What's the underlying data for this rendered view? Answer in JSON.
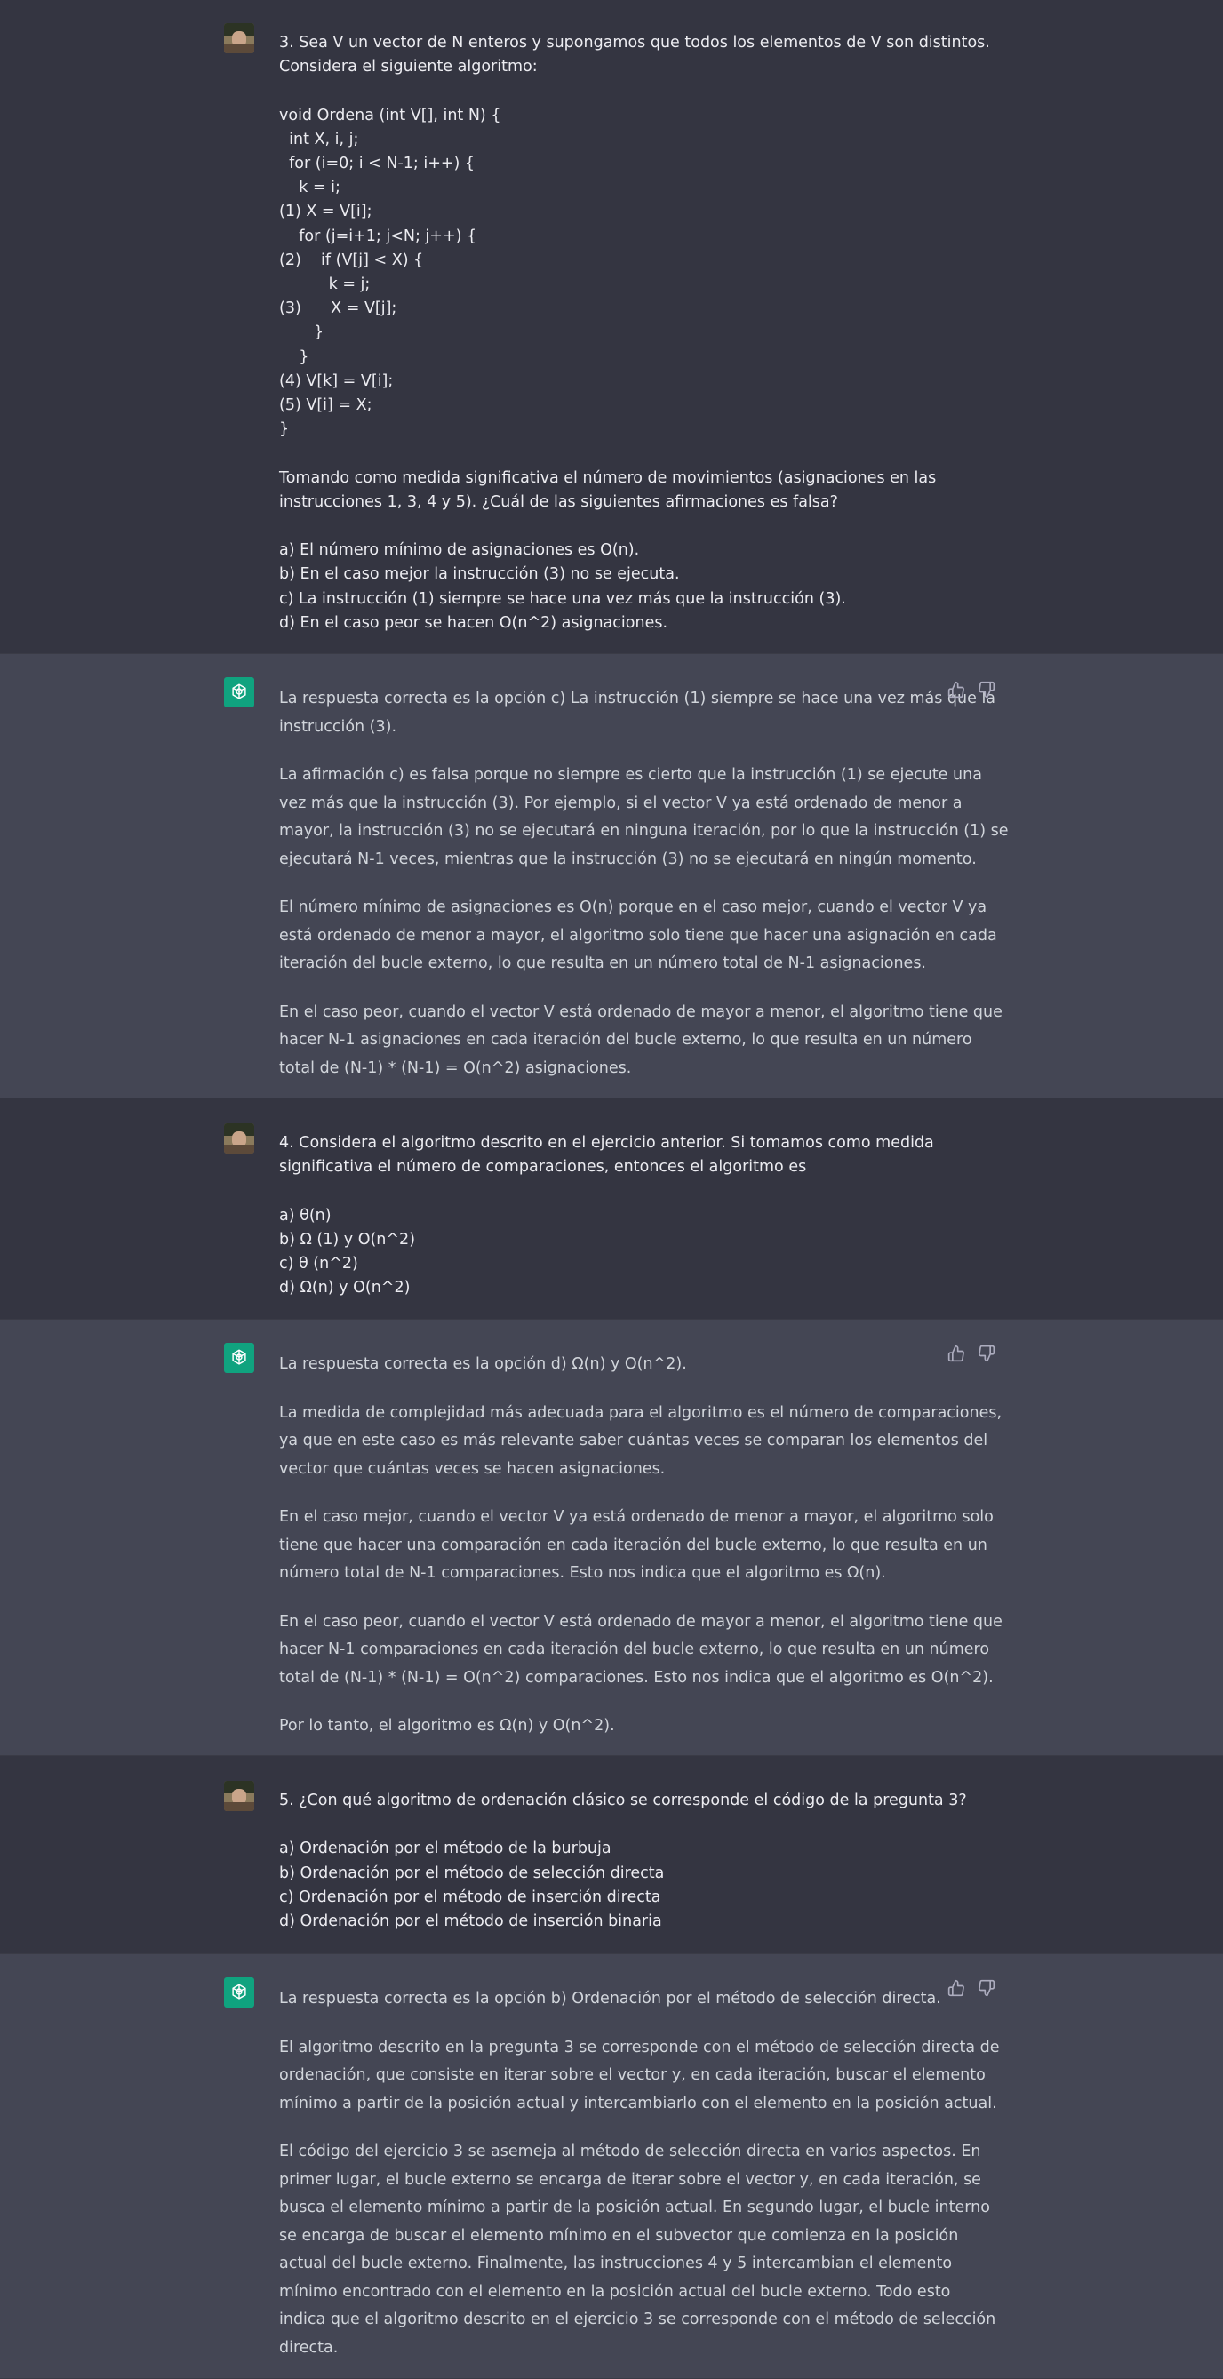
{
  "conversation": [
    {
      "role": "user",
      "paragraphs": [
        [
          "3. Sea V un vector de N enteros y supongamos que todos los elementos de V son distintos.",
          "Considera el siguiente algoritmo:"
        ],
        [
          "void Ordena (int V[], int N) {",
          "  int X, i, j;",
          "  for (i=0; i < N-1; i++) {",
          "    k = i;",
          "(1) X = V[i];",
          "    for (j=i+1; j<N; j++) {",
          "(2)    if (V[j] < X) {",
          "          k = j;",
          "(3)      X = V[j];",
          "       }",
          "    }",
          "(4) V[k] = V[i];",
          "(5) V[i] = X;",
          "}"
        ],
        [
          "Tomando como medida significativa el número de movimientos (asignaciones en las",
          "instrucciones 1, 3, 4 y 5). ¿Cuál de las siguientes afirmaciones es falsa?"
        ],
        [
          "a) El número mínimo de asignaciones es O(n).",
          "b) En el caso mejor la instrucción (3) no se ejecuta.",
          "c) La instrucción (1) siempre se hace una vez más que la instrucción (3).",
          "d) En el caso peor se hacen O(n^2) asignaciones."
        ]
      ]
    },
    {
      "role": "assistant",
      "paragraphs": [
        [
          "La respuesta correcta es la opción c) La instrucción (1) siempre se hace una vez más que la",
          "instrucción (3)."
        ],
        [
          "La afirmación c) es falsa porque no siempre es cierto que la instrucción (1) se ejecute una",
          "vez más que la instrucción (3). Por ejemplo, si el vector V ya está ordenado de menor a",
          "mayor, la instrucción (3) no se ejecutará en ninguna iteración, por lo que la instrucción (1) se",
          "ejecutará N-1 veces, mientras que la instrucción (3) no se ejecutará en ningún momento."
        ],
        [
          "El número mínimo de asignaciones es O(n) porque en el caso mejor, cuando el vector V ya",
          "está ordenado de menor a mayor, el algoritmo solo tiene que hacer una asignación en cada",
          "iteración del bucle externo, lo que resulta en un número total de N-1 asignaciones."
        ],
        [
          "En el caso peor, cuando el vector V está ordenado de mayor a menor, el algoritmo tiene que",
          "hacer N-1 asignaciones en cada iteración del bucle externo, lo que resulta en un número",
          "total de (N-1) * (N-1) = O(n^2) asignaciones."
        ]
      ]
    },
    {
      "role": "user",
      "paragraphs": [
        [
          "4. Considera el algoritmo descrito en el ejercicio anterior. Si tomamos como medida",
          "significativa el número de comparaciones, entonces el algoritmo es"
        ],
        [
          "a) θ(n)",
          "b) Ω (1) y O(n^2)",
          "c) θ (n^2)",
          "d) Ω(n) y O(n^2)"
        ]
      ]
    },
    {
      "role": "assistant",
      "paragraphs": [
        [
          "La respuesta correcta es la opción d) Ω(n) y O(n^2)."
        ],
        [
          "La medida de complejidad más adecuada para el algoritmo es el número de comparaciones,",
          "ya que en este caso es más relevante saber cuántas veces se comparan los elementos del",
          "vector que cuántas veces se hacen asignaciones."
        ],
        [
          "En el caso mejor, cuando el vector V ya está ordenado de menor a mayor, el algoritmo solo",
          "tiene que hacer una comparación en cada iteración del bucle externo, lo que resulta en un",
          "número total de N-1 comparaciones. Esto nos indica que el algoritmo es Ω(n)."
        ],
        [
          "En el caso peor, cuando el vector V está ordenado de mayor a menor, el algoritmo tiene que",
          "hacer N-1 comparaciones en cada iteración del bucle externo, lo que resulta en un número",
          "total de (N-1) * (N-1) = O(n^2) comparaciones. Esto nos indica que el algoritmo es O(n^2)."
        ],
        [
          "Por lo tanto, el algoritmo es Ω(n) y O(n^2)."
        ]
      ]
    },
    {
      "role": "user",
      "paragraphs": [
        [
          "5. ¿Con qué algoritmo de ordenación clásico se corresponde el código de la pregunta 3?"
        ],
        [
          "a) Ordenación por el método de la burbuja",
          "b) Ordenación por el método de selección directa",
          "c) Ordenación por el método de inserción directa",
          "d) Ordenación por el método de inserción binaria"
        ]
      ]
    },
    {
      "role": "assistant",
      "paragraphs": [
        [
          "La respuesta correcta es la opción b) Ordenación por el método de selección directa."
        ],
        [
          "El algoritmo descrito en la pregunta 3 se corresponde con el método de selección directa de",
          "ordenación, que consiste en iterar sobre el vector y, en cada iteración, buscar el elemento",
          "mínimo a partir de la posición actual y intercambiarlo con el elemento en la posición actual."
        ],
        [
          "El código del ejercicio 3 se asemeja al método de selección directa en varios aspectos. En",
          "primer lugar, el bucle externo se encarga de iterar sobre el vector y, en cada iteración, se",
          "busca el elemento mínimo a partir de la posición actual. En segundo lugar, el bucle interno",
          "se encarga de buscar el elemento mínimo en el subvector que comienza en la posición",
          "actual del bucle externo. Finalmente, las instrucciones 4 y 5 intercambian el elemento",
          "mínimo encontrado con el elemento en la posición actual del bucle externo. Todo esto",
          "indica que el algoritmo descrito en el ejercicio 3 se corresponde con el método de selección",
          "directa."
        ]
      ]
    }
  ],
  "colors": {
    "user_bg": "#343541",
    "assistant_bg": "#444654",
    "assistant_avatar": "#10a37f",
    "user_text": "#ececf1",
    "assistant_text": "#d1d5db"
  },
  "icons": {
    "assistant_avatar": "openai-logo-icon",
    "thumbs_up": "thumbs-up-icon",
    "thumbs_down": "thumbs-down-icon"
  }
}
